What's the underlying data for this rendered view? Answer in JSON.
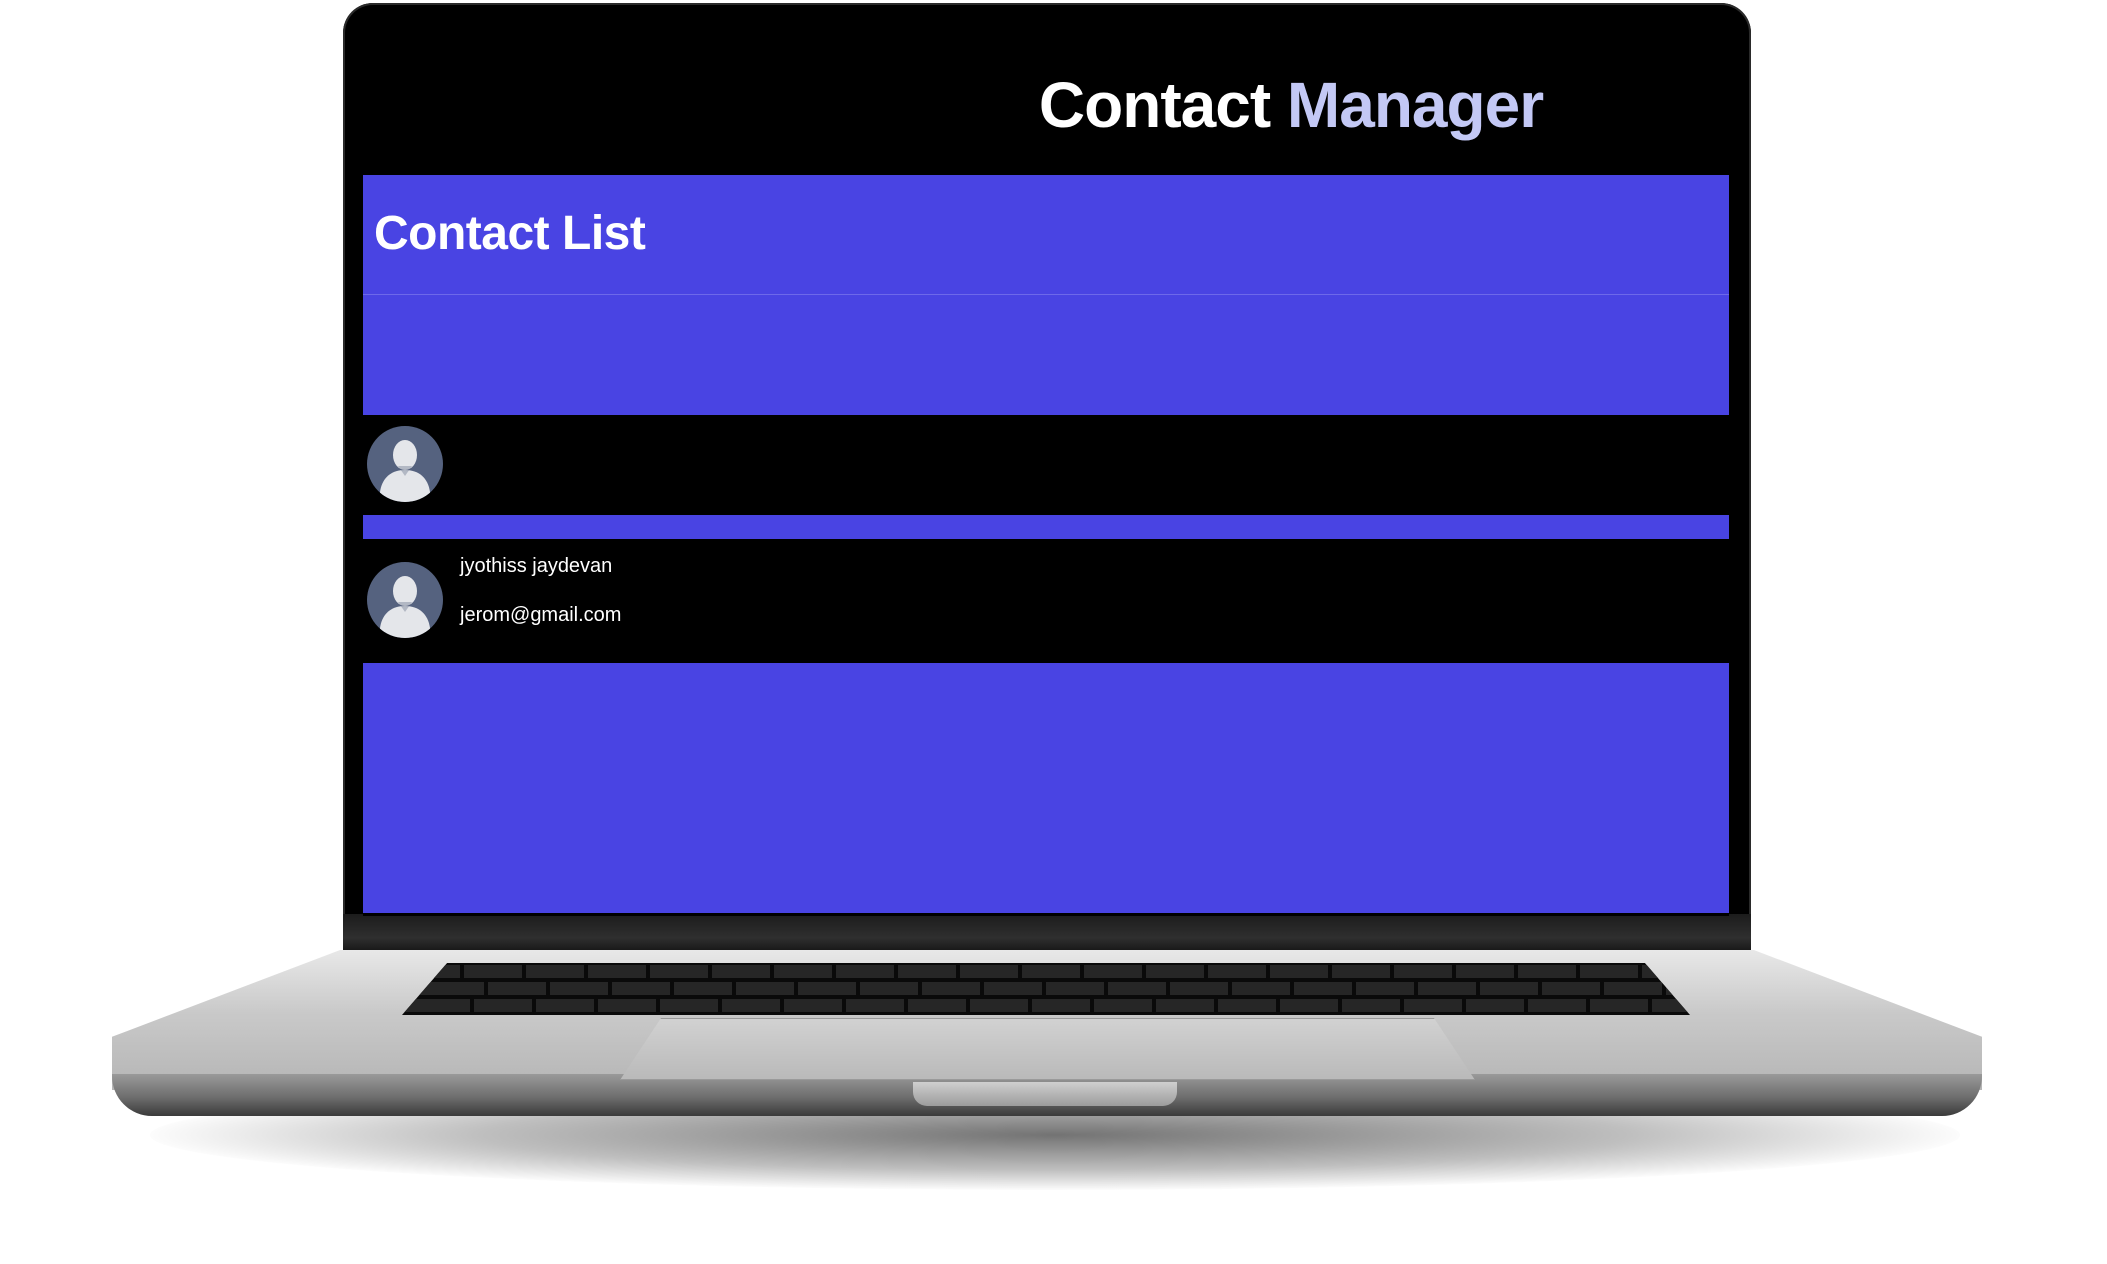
{
  "app": {
    "title_part1": "Contact ",
    "title_part2": "Manager"
  },
  "contact_list": {
    "heading": "Contact List"
  },
  "contacts": [
    {
      "name": "",
      "email": "",
      "avatar_icon": "user-silhouette-icon"
    },
    {
      "name": "jyothiss jaydevan",
      "email": "jerom@gmail.com",
      "avatar_icon": "user-silhouette-icon"
    }
  ],
  "colors": {
    "panel_blue": "#4944e3",
    "background": "#000000",
    "title_accent": "#c3c8f5",
    "avatar_bg": "#55627f"
  }
}
